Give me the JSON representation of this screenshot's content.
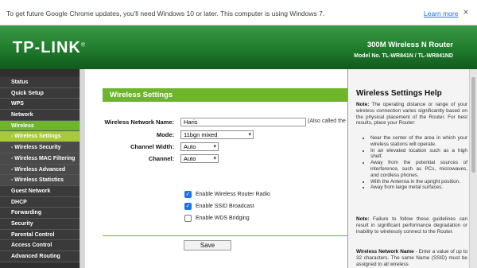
{
  "infobar": {
    "message": "To get future Google Chrome updates, you'll need Windows 10 or later. This computer is using Windows 7.",
    "learn_more": "Learn more",
    "close": "×"
  },
  "header": {
    "logo": "TP-LINK",
    "logo_mark": "®",
    "product": "300M Wireless N Router",
    "model_no": "Model No. TL-WR841N / TL-WR841ND"
  },
  "menu": {
    "items": [
      {
        "label": "Status"
      },
      {
        "label": "Quick Setup"
      },
      {
        "label": "WPS"
      },
      {
        "label": "Network"
      },
      {
        "label": "Wireless"
      },
      {
        "label": "- Wireless Settings"
      },
      {
        "label": "- Wireless Security"
      },
      {
        "label": "- Wireless MAC Filtering"
      },
      {
        "label": "- Wireless Advanced"
      },
      {
        "label": "- Wireless Statistics"
      },
      {
        "label": "Guest Network"
      },
      {
        "label": "DHCP"
      },
      {
        "label": "Forwarding"
      },
      {
        "label": "Security"
      },
      {
        "label": "Parental Control"
      },
      {
        "label": "Access Control"
      },
      {
        "label": "Advanced Routing"
      }
    ]
  },
  "main": {
    "section_title": "Wireless Settings",
    "network_name_label": "Wireless Network Name:",
    "network_name_value": "Haris",
    "network_name_note": "(Also called the",
    "mode_label": "Mode:",
    "mode_value": "11bgn mixed",
    "channel_width_label": "Channel Width:",
    "channel_width_value": "Auto",
    "channel_label": "Channel:",
    "channel_value": "Auto",
    "enable_radio_label": "Enable Wireless Router Radio",
    "enable_ssid_label": "Enable SSID Broadcast",
    "enable_wds_label": "Enable WDS Bridging",
    "save_label": "Save"
  },
  "help": {
    "title": "Wireless Settings Help",
    "note1_label": "Note:",
    "note1": "The operating distance or range of your wireless connection varies significantly based on the physical placement of the Router. For best results, place your Router:",
    "bullets": [
      "Near the center of the area in which your wireless stations will operate.",
      "In an elevated location such as a high shelf.",
      "Away from the potential sources of interference, such as PCs, microwaves, and cordless phones.",
      "With the Antenna in the upright position.",
      "Away from large metal surfaces."
    ],
    "note2_label": "Note:",
    "note2": "Failure to follow these guidelines can result in significant performance degradation or inability to wirelessly connect to the Router.",
    "name_label": "Wireless Network Name",
    "name_text": "- Enter a value of up to 32 characters. The same Name (SSID) must be assigned to all wireless"
  }
}
